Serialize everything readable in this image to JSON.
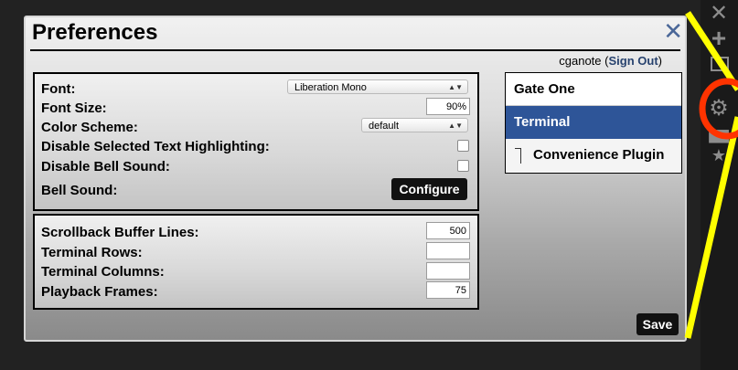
{
  "dialog": {
    "title": "Preferences",
    "close_glyph": "✕",
    "user": {
      "name": "cganote",
      "open_paren": " (",
      "sign_out": "Sign Out",
      "close_paren": ")"
    }
  },
  "general_panel": {
    "font": {
      "label": "Font:",
      "value": "Liberation Mono"
    },
    "font_size": {
      "label": "Font Size:",
      "value": "90%"
    },
    "color_scheme": {
      "label": "Color Scheme:",
      "value": "default"
    },
    "disable_highlight": {
      "label": "Disable Selected Text Highlighting:",
      "checked": false
    },
    "disable_bell": {
      "label": "Disable Bell Sound:",
      "checked": false
    },
    "bell_sound": {
      "label": "Bell Sound:",
      "button": "Configure"
    }
  },
  "terminal_panel": {
    "scrollback": {
      "label": "Scrollback Buffer Lines:",
      "value": "500"
    },
    "rows": {
      "label": "Terminal Rows:",
      "value": ""
    },
    "columns": {
      "label": "Terminal Columns:",
      "value": ""
    },
    "playback": {
      "label": "Playback Frames:",
      "value": "75"
    }
  },
  "plugins": {
    "items": [
      "Gate One",
      "Terminal",
      "Convenience Plugin"
    ],
    "selected": "Terminal"
  },
  "actions": {
    "save": "Save"
  },
  "toolbar_icons": [
    "close-icon",
    "plus-icon",
    "terminal-icon",
    "gear-icon",
    "grid-icon",
    "star-icon"
  ],
  "colors": {
    "selected_plugin": "#2e5598",
    "annotation": "#ffff00",
    "highlight_circle": "#ff3300",
    "close_x": "#4a6798"
  }
}
